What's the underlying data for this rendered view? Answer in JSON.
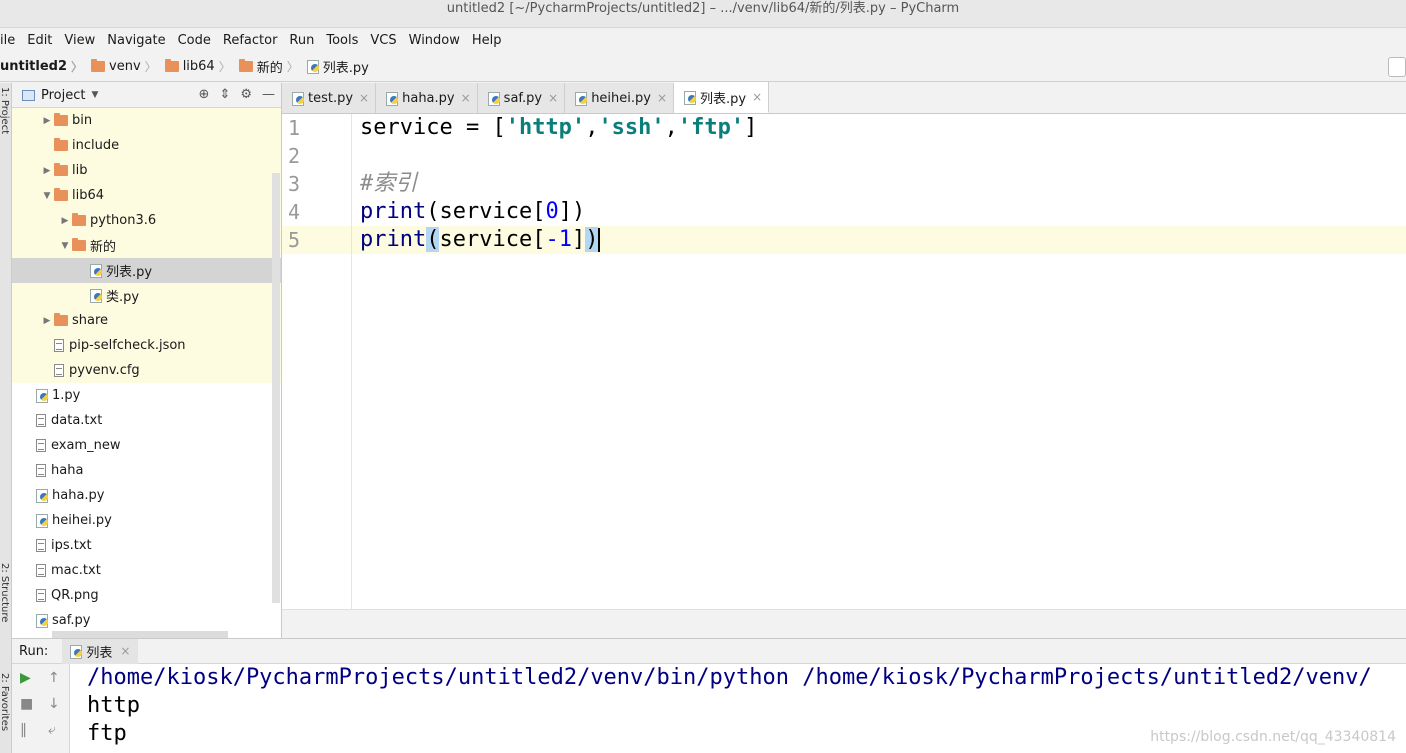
{
  "window": {
    "title": "untitled2 [~/PycharmProjects/untitled2] – .../venv/lib64/新的/列表.py – PyCharm"
  },
  "menu": [
    "ile",
    "Edit",
    "View",
    "Navigate",
    "Code",
    "Refactor",
    "Run",
    "Tools",
    "VCS",
    "Window",
    "Help"
  ],
  "breadcrumb": [
    "untitled2",
    "venv",
    "lib64",
    "新的",
    "列表.py"
  ],
  "project": {
    "header": "Project",
    "rows": [
      {
        "label": "bin",
        "type": "folder",
        "indent": 2,
        "arrow": "▶",
        "hl": true
      },
      {
        "label": "include",
        "type": "folder",
        "indent": 2,
        "arrow": "",
        "hl": true
      },
      {
        "label": "lib",
        "type": "folder",
        "indent": 2,
        "arrow": "▶",
        "hl": true
      },
      {
        "label": "lib64",
        "type": "folder",
        "indent": 2,
        "arrow": "▼",
        "hl": true
      },
      {
        "label": "python3.6",
        "type": "folder",
        "indent": 3,
        "arrow": "▶",
        "hl": true
      },
      {
        "label": "新的",
        "type": "folder",
        "indent": 3,
        "arrow": "▼",
        "hl": true
      },
      {
        "label": "列表.py",
        "type": "py",
        "indent": 4,
        "arrow": "",
        "sel": true
      },
      {
        "label": "类.py",
        "type": "py",
        "indent": 4,
        "arrow": "",
        "hl": true
      },
      {
        "label": "share",
        "type": "folder",
        "indent": 2,
        "arrow": "▶",
        "hl": true
      },
      {
        "label": "pip-selfcheck.json",
        "type": "file",
        "indent": 2,
        "arrow": "",
        "hl": true
      },
      {
        "label": "pyvenv.cfg",
        "type": "file",
        "indent": 2,
        "arrow": "",
        "hl": true
      },
      {
        "label": "1.py",
        "type": "py",
        "indent": 1,
        "arrow": ""
      },
      {
        "label": "data.txt",
        "type": "file",
        "indent": 1,
        "arrow": ""
      },
      {
        "label": "exam_new",
        "type": "file",
        "indent": 1,
        "arrow": ""
      },
      {
        "label": "haha",
        "type": "file",
        "indent": 1,
        "arrow": ""
      },
      {
        "label": "haha.py",
        "type": "py",
        "indent": 1,
        "arrow": ""
      },
      {
        "label": "heihei.py",
        "type": "py",
        "indent": 1,
        "arrow": ""
      },
      {
        "label": "ips.txt",
        "type": "file",
        "indent": 1,
        "arrow": ""
      },
      {
        "label": "mac.txt",
        "type": "file",
        "indent": 1,
        "arrow": ""
      },
      {
        "label": "QR.png",
        "type": "file",
        "indent": 1,
        "arrow": ""
      },
      {
        "label": "saf.py",
        "type": "py",
        "indent": 1,
        "arrow": ""
      }
    ]
  },
  "tabs": [
    {
      "label": "test.py",
      "active": false
    },
    {
      "label": "haha.py",
      "active": false
    },
    {
      "label": "saf.py",
      "active": false
    },
    {
      "label": "heihei.py",
      "active": false
    },
    {
      "label": "列表.py",
      "active": true
    }
  ],
  "editor": {
    "line_numbers": [
      "1",
      "2",
      "3",
      "4",
      "5"
    ],
    "line1": {
      "a": "service = [",
      "s1": "'http'",
      "c1": ",",
      "s2": "'ssh'",
      "c2": ",",
      "s3": "'ftp'",
      "b": "]"
    },
    "line3": "#索引",
    "line4": {
      "fn": "print",
      "a": "(service[",
      "n": "0",
      "b": "])"
    },
    "line5": {
      "fn": "print",
      "p1": "(",
      "a": "service[",
      "n": "-1",
      "b": "]",
      "p2": ")"
    }
  },
  "run": {
    "label": "Run:",
    "tab": "列表",
    "output": [
      "/home/kiosk/PycharmProjects/untitled2/venv/bin/python /home/kiosk/PycharmProjects/untitled2/venv/",
      "http",
      "ftp"
    ]
  },
  "sidebar": {
    "project_label": "1: Project",
    "structure_label": "2: Structure",
    "favorites_label": "2: Favorites"
  },
  "watermark": "https://blog.csdn.net/qq_43340814"
}
